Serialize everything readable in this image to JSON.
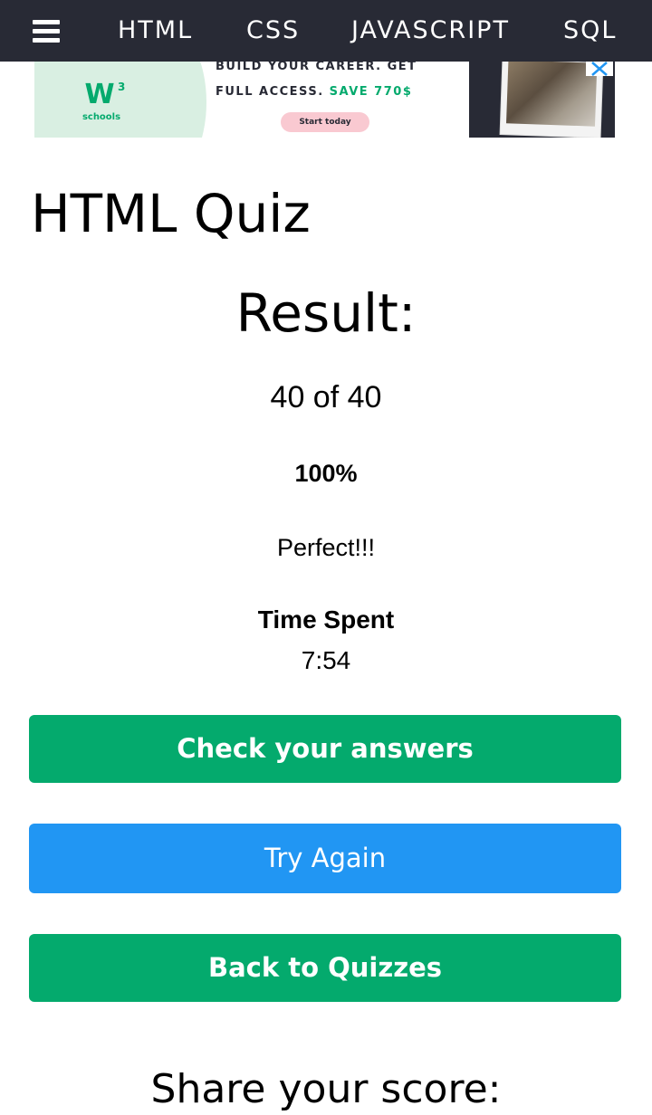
{
  "nav": {
    "menu_icon": "hamburger-menu-icon",
    "links": [
      "HTML",
      "CSS",
      "JAVASCRIPT",
      "SQL"
    ]
  },
  "ad": {
    "logo_text": "W",
    "logo_sup": "3",
    "logo_sub": "schools",
    "line1": "BUILD YOUR CAREER. GET",
    "line2_prefix": "FULL ACCESS.",
    "line2_highlight": "SAVE 770$",
    "cta": "Start today",
    "close_icon": "close-icon",
    "colors": {
      "accent": "#04aa6d",
      "dark": "#282a35",
      "cta_bg": "#f9c9d1"
    }
  },
  "page": {
    "title": "HTML Quiz"
  },
  "result": {
    "heading": "Result:",
    "score": "40 of 40",
    "percent": "100%",
    "grade": "Perfect!!!",
    "time_label": "Time Spent",
    "time_value": "7:54"
  },
  "buttons": {
    "check": "Check your answers",
    "try_again": "Try Again",
    "back": "Back to Quizzes",
    "colors": {
      "green": "#04aa6d",
      "blue": "#2196f3"
    }
  },
  "share": {
    "heading": "Share your score:"
  }
}
